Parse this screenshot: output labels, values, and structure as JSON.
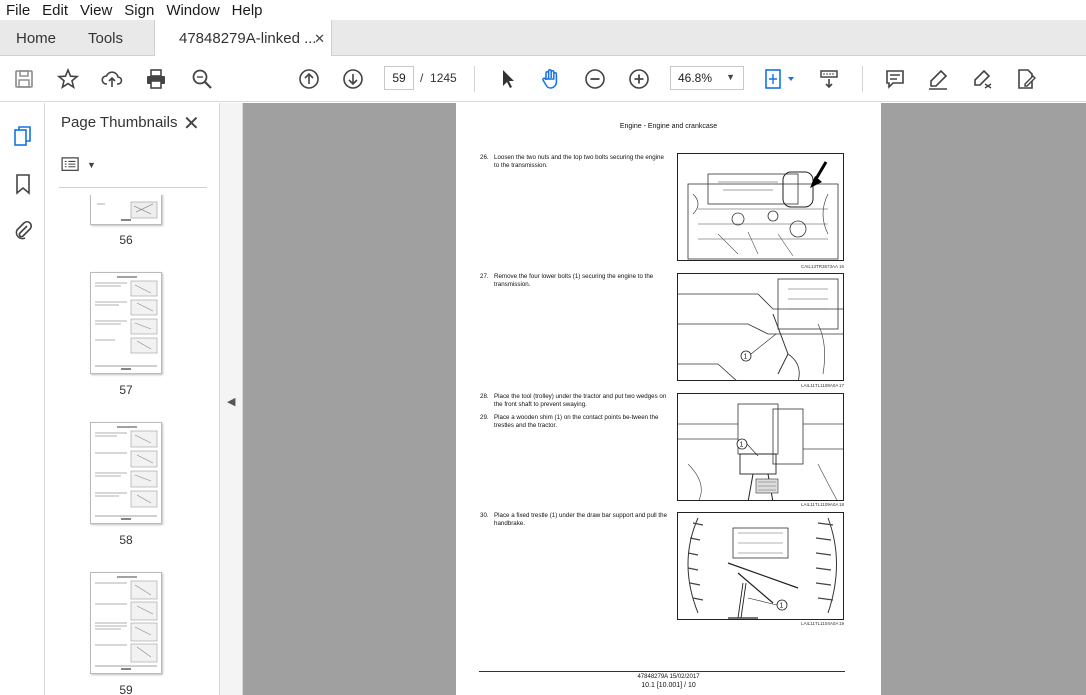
{
  "menu": [
    "File",
    "Edit",
    "View",
    "Sign",
    "Window",
    "Help"
  ],
  "tabs": {
    "home": "Home",
    "tools": "Tools",
    "document": "47848279A-linked ...",
    "close": "✕"
  },
  "nav": {
    "current_page": "59",
    "separator": "/",
    "total_pages": "1245",
    "zoom": "46.8%"
  },
  "panel": {
    "title": "Page Thumbnails",
    "close": "✕",
    "thumbnails": [
      "56",
      "57",
      "58",
      "59"
    ],
    "selected": "59"
  },
  "document": {
    "header": "Engine - Engine and crankcase",
    "steps": [
      {
        "num": "26.",
        "text": "Loosen the two nuts and the top two bolts securing the engine to the transmission."
      },
      {
        "num": "27.",
        "text": "Remove the four lower bolts (1) securing the engine to the transmission."
      },
      {
        "num": "28.",
        "text": "Place the tool (trolley) under the tractor and put two wedges on the front shaft to prevent swaying."
      },
      {
        "num": "29.",
        "text": "Place a wooden shim (1) on the contact points be-tween the trestles and the tractor."
      },
      {
        "num": "30.",
        "text": "Place a fixed trestle (1) under the draw bar support and pull the handbrake."
      }
    ],
    "figures": [
      {
        "code": "CAIL13TR3673AA",
        "num": "16"
      },
      {
        "code": "LAIL11TL1108A0A",
        "num": "17"
      },
      {
        "code": "LAIL11TL1109A0A",
        "num": "18"
      },
      {
        "code": "LAIL11TL1104A0A",
        "num": "19"
      }
    ],
    "footer_line1": "47848279A 15/02/2017",
    "footer_line2": "10.1 [10.001] / 10"
  },
  "colors": {
    "accent_blue": "#1473e6",
    "viewer_bg": "#a0a0a0"
  }
}
